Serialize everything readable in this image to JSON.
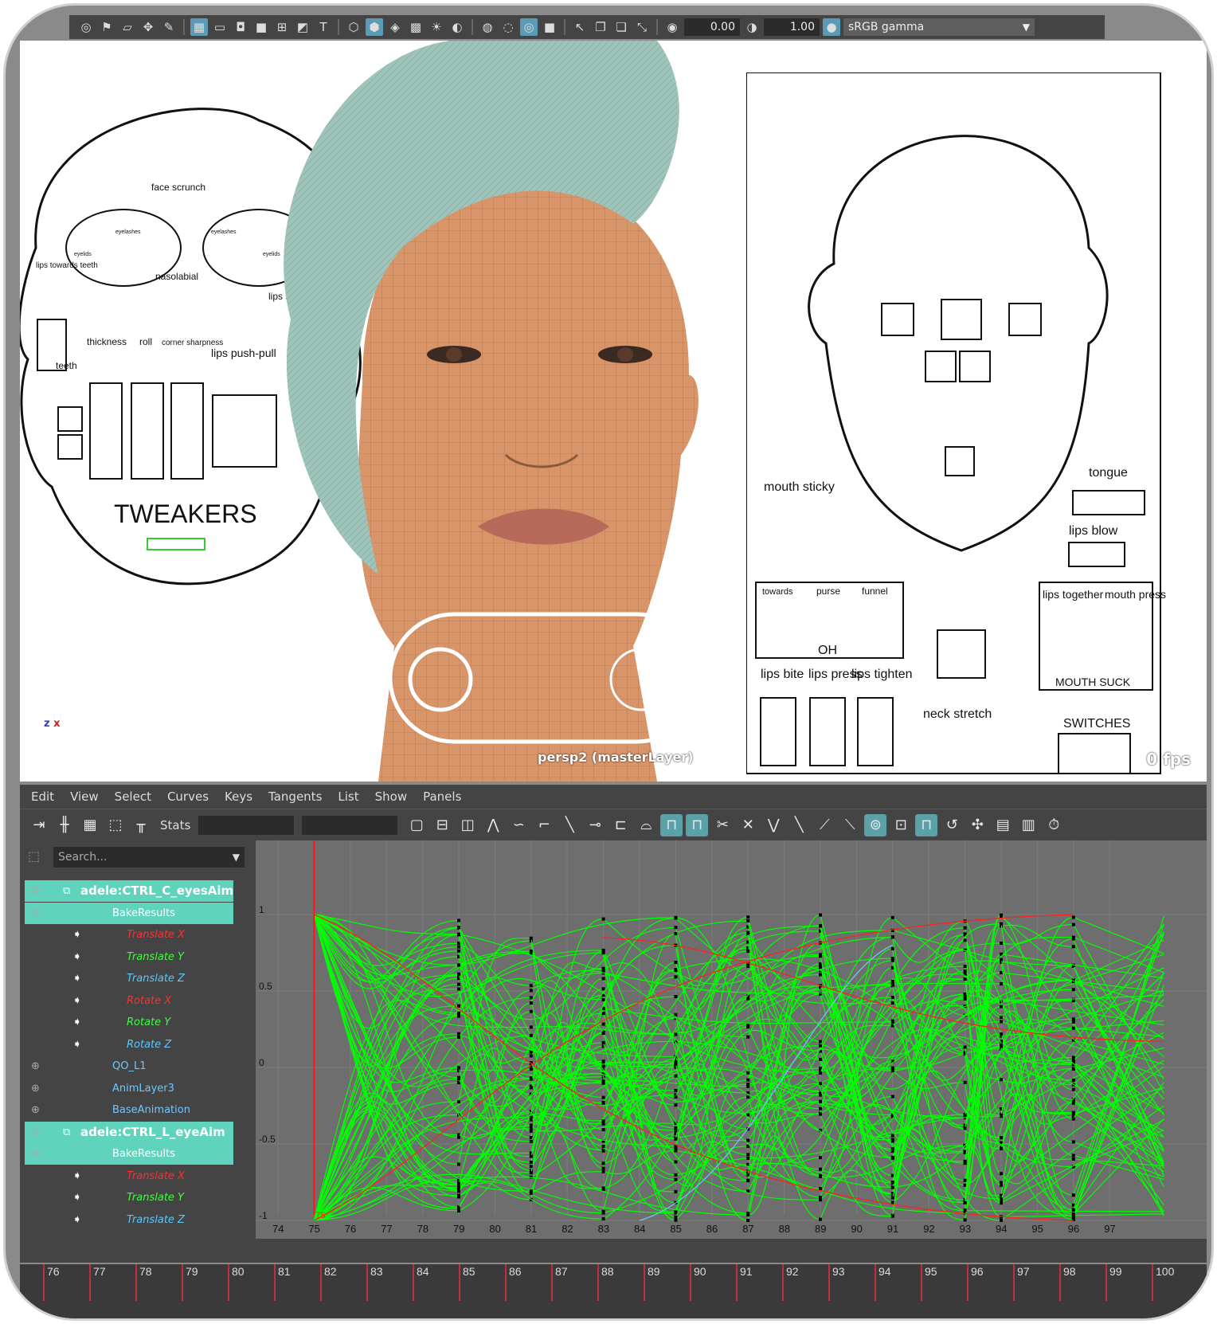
{
  "toolbar": {
    "exposure_value": "0.00",
    "gamma_value": "1.00",
    "colorspace": "sRGB gamma"
  },
  "viewport": {
    "camera_label": "persp2 (masterLayer)",
    "fps_label": "0 fps",
    "axis_z": "z",
    "axis_x": "x",
    "left_picker": {
      "title": "TWEAKERS",
      "labels": [
        "face scrunch",
        "eyelashes",
        "eyelids",
        "eyelashes",
        "eyelids",
        "nasolabial",
        "lips towards teeth",
        "lips shift",
        "thickness",
        "roll",
        "corner sharpness",
        "lips push-pull",
        "teeth"
      ]
    },
    "right_picker": {
      "labels": [
        "mouth sticky",
        "tongue",
        "lips blow",
        "towards",
        "purse",
        "funnel",
        "OH",
        "lips together",
        "mouth press",
        "MOUTH SUCK",
        "lips bite",
        "lips press",
        "lips tighten",
        "neck stretch",
        "SWITCHES"
      ]
    }
  },
  "graph_editor": {
    "menus": [
      "Edit",
      "View",
      "Select",
      "Curves",
      "Keys",
      "Tangents",
      "List",
      "Show",
      "Panels"
    ],
    "stats_label": "Stats",
    "search_placeholder": "Search...",
    "outliner": [
      {
        "label": "adele:CTRL_C_eyesAim",
        "kind": "node",
        "selected": true
      },
      {
        "label": "BakeResults",
        "kind": "bake",
        "selected": true
      },
      {
        "label": "Translate X",
        "kind": "tx"
      },
      {
        "label": "Translate Y",
        "kind": "ty"
      },
      {
        "label": "Translate Z",
        "kind": "tz"
      },
      {
        "label": "Rotate X",
        "kind": "tx"
      },
      {
        "label": "Rotate Y",
        "kind": "ty"
      },
      {
        "label": "Rotate Z",
        "kind": "tz"
      },
      {
        "label": "QO_L1",
        "kind": "layer"
      },
      {
        "label": "AnimLayer3",
        "kind": "layer"
      },
      {
        "label": "BaseAnimation",
        "kind": "layer"
      },
      {
        "label": "adele:CTRL_L_eyeAim",
        "kind": "node",
        "selected": true
      },
      {
        "label": "BakeResults",
        "kind": "bake",
        "selected": true
      },
      {
        "label": "Translate X",
        "kind": "tx"
      },
      {
        "label": "Translate Y",
        "kind": "ty"
      },
      {
        "label": "Translate Z",
        "kind": "tz"
      }
    ],
    "y_ticks": [
      "1",
      "0.5",
      "0",
      "-0.5",
      "-1"
    ],
    "x_ticks": [
      "74",
      "75",
      "76",
      "77",
      "78",
      "79",
      "80",
      "81",
      "82",
      "83",
      "84",
      "85",
      "86",
      "87",
      "88",
      "89",
      "90",
      "91",
      "92",
      "93",
      "94",
      "95",
      "96",
      "97"
    ],
    "current_frame": "75"
  },
  "timeline": {
    "ticks": [
      "76",
      "77",
      "78",
      "79",
      "80",
      "81",
      "82",
      "83",
      "84",
      "85",
      "86",
      "87",
      "88",
      "89",
      "90",
      "91",
      "92",
      "93",
      "94",
      "95",
      "96",
      "97",
      "98",
      "99",
      "100"
    ]
  }
}
